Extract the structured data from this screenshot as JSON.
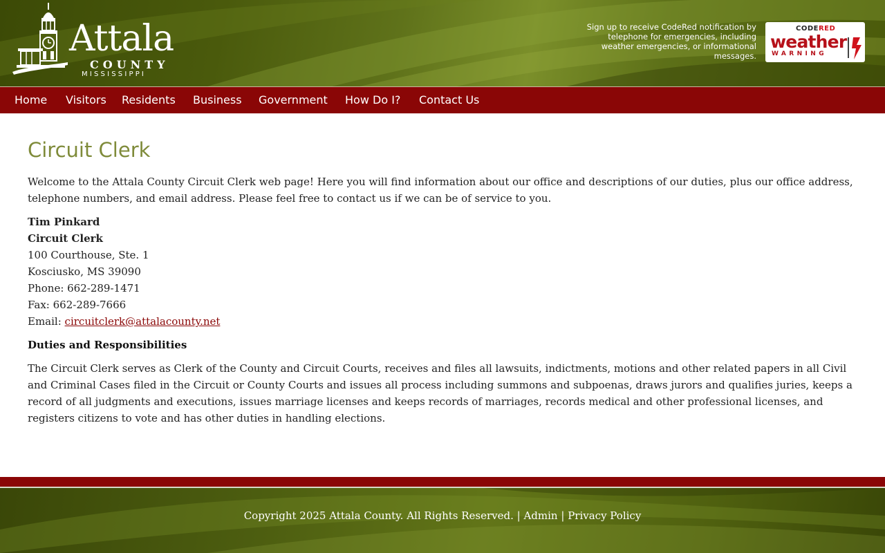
{
  "header": {
    "logo": {
      "name": "Attala",
      "county": "COUNTY",
      "state": "MISSISSIPPI",
      "icon": "courthouse-icon"
    },
    "codered": {
      "notice": "Sign up to receive CodeRed notification by telephone for emergencies, including weather emergencies, or informational messages.",
      "badge_code": "CODE",
      "badge_red": "RED",
      "badge_weather": "weather",
      "badge_warning": "WARNING"
    }
  },
  "nav": {
    "items": [
      {
        "label": "Home"
      },
      {
        "label": "Visitors"
      },
      {
        "label": "Residents"
      },
      {
        "label": "Business"
      },
      {
        "label": "Government"
      },
      {
        "label": "How Do I?"
      },
      {
        "label": "Contact Us"
      }
    ]
  },
  "main": {
    "title": "Circuit Clerk",
    "intro": "Welcome to the Attala County Circuit Clerk web page! Here you will find information about our office and descriptions of our duties, plus our office address, telephone numbers, and email address.  Please feel free to contact us if we can be of service to you.",
    "contact": {
      "name": "Tim Pinkard",
      "role": "Circuit Clerk",
      "address1": "100 Courthouse, Ste. 1",
      "address2": "Kosciusko, MS 39090",
      "phone": "Phone: 662-289-1471",
      "fax": "Fax: 662-289-7666",
      "email_label": "Email: ",
      "email": "circuitclerk@attalacounty.net"
    },
    "duties_title": "Duties and Responsibilities",
    "duties": "The Circuit Clerk serves as Clerk of the County and Circuit Courts, receives and files all lawsuits, indictments, motions and other related papers in all Civil and Criminal Cases filed in the Circuit or County Courts and issues all process including summons and subpoenas, draws jurors and qualifies juries, keeps a record of all judgments and executions, issues marriage licenses and keeps records of marriages, records medical and other professional licenses, and registers citizens to vote and has other duties in handling elections."
  },
  "footer": {
    "copyright": "Copyright 2025 Attala County. All Rights Reserved.",
    "separator": " | ",
    "admin": "Admin",
    "privacy": "Privacy Policy"
  },
  "colors": {
    "nav_bg": "#8a0606",
    "title_olive": "#7f8b3a",
    "header_green": "#4a5a0c"
  }
}
